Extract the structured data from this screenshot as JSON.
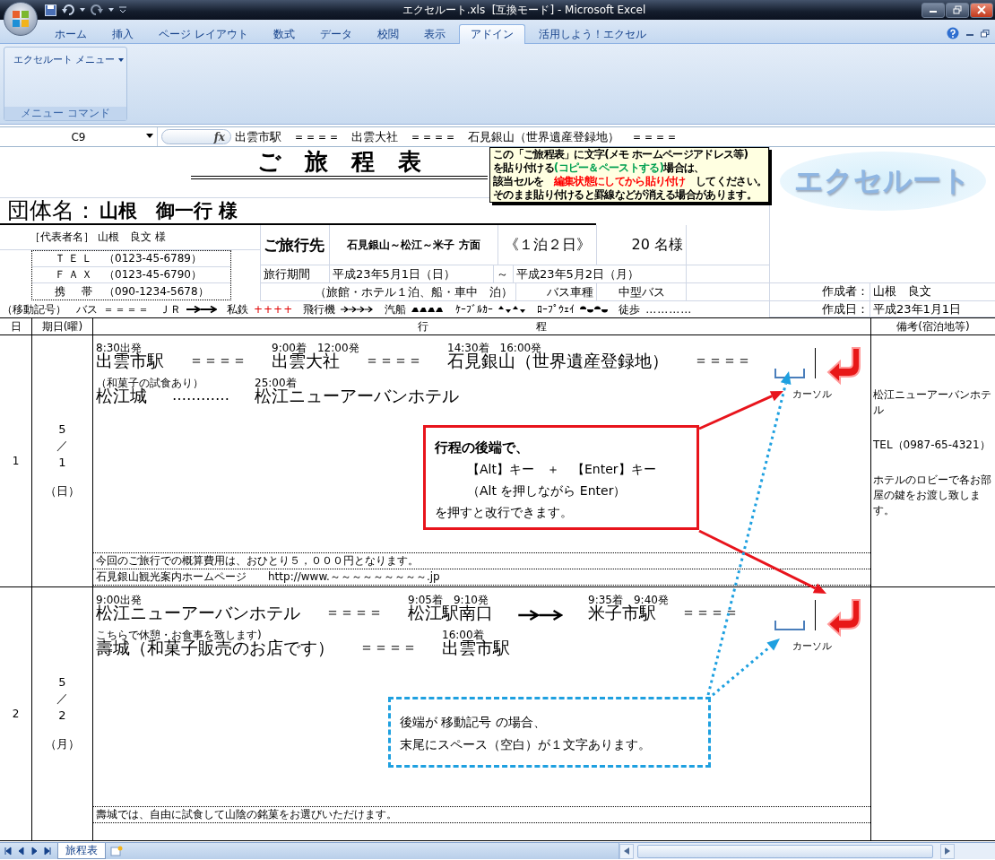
{
  "window": {
    "title": "エクセルート.xls  [互換モード] - Microsoft Excel"
  },
  "ribbon": {
    "tabs": [
      {
        "label": "ホーム",
        "selected": false
      },
      {
        "label": "挿入",
        "selected": false
      },
      {
        "label": "ページ レイアウト",
        "selected": false
      },
      {
        "label": "数式",
        "selected": false
      },
      {
        "label": "データ",
        "selected": false
      },
      {
        "label": "校閲",
        "selected": false
      },
      {
        "label": "表示",
        "selected": false
      },
      {
        "label": "アドイン",
        "selected": true
      },
      {
        "label": "活用しよう！エクセル",
        "selected": false
      }
    ],
    "menu_button": "エクセルート メニュー",
    "group_label": "メニュー コマンド"
  },
  "formula_bar": {
    "cell": "C9",
    "function_symbol": "fx",
    "content": "出雲市駅　＝＝＝＝　出雲大社　＝＝＝＝　石見銀山（世界遺産登録地）　＝＝＝＝"
  },
  "header": {
    "title": "ご　旅　程　表",
    "note": [
      [
        {
          "text": "この「ご旅程表」に文字(メモ ホームページアドレス等)"
        }
      ],
      [
        {
          "text": "を貼り付ける"
        },
        {
          "text": "(コピー＆ペーストする)",
          "color": "#00a050"
        },
        {
          "text": "場合は、"
        }
      ],
      [
        {
          "text": "該当セルを　"
        },
        {
          "text": "編集状態にしてから貼り付け",
          "color": "#ff0000"
        },
        {
          "text": "　してください。"
        }
      ],
      [
        {
          "text": "そのまま貼り付けると罫線などが消える場合があります。"
        }
      ]
    ],
    "logo": "エクセルート",
    "group_label": "団体名：",
    "group_name": "山根　御一行 様",
    "rep_label": "［代表者名］",
    "rep_name": "山根　良文 様",
    "contacts": [
      {
        "label": "ＴＥＬ",
        "value": "（0123-45-6789）"
      },
      {
        "label": "ＦＡＸ",
        "value": "（0123-45-6790）"
      },
      {
        "label": "携　帯",
        "value": "（090-1234-5678）"
      }
    ],
    "destination_label": "ご旅行先",
    "destination": "石見銀山～松江～米子 方面",
    "duration": "《１泊２日》",
    "party": "20 名様",
    "period_label": "旅行期間",
    "start": "平成23年5月1日（日）",
    "tilde": "～",
    "end": "平成23年5月2日（月）",
    "lodging": "（旅館・ホテル１泊、船・車中　泊）",
    "bus_label": "バス車種",
    "bus": "中型バス",
    "author_label": "作成者：",
    "author": "山根　良文",
    "created_label": "作成日：",
    "created": "平成23年1月1日",
    "legend_title": "（移動記号）",
    "legend": [
      {
        "label": "バス",
        "kind": "text",
        "symbol": "＝＝＝＝"
      },
      {
        "label": "ＪＲ",
        "kind": "jr"
      },
      {
        "label": "私鉄",
        "kind": "rail",
        "symbol": "++++"
      },
      {
        "label": "飛行機",
        "kind": "plane"
      },
      {
        "label": "汽船",
        "kind": "ship"
      },
      {
        "label": "ｹｰﾌﾞﾙｶｰ",
        "kind": "cable"
      },
      {
        "label": "ﾛｰﾌﾟｳｪｲ",
        "kind": "rope"
      },
      {
        "label": "徒歩",
        "kind": "text",
        "symbol": "…………"
      }
    ]
  },
  "table": {
    "columns": [
      "日",
      "期日(曜)",
      "行　　　　　　　　　　程",
      "備考(宿泊地等)"
    ],
    "days": [
      {
        "day": "1",
        "date": [
          "5",
          "／",
          "1"
        ],
        "weekday": "（日）",
        "lines": [
          {
            "items": [
              {
                "kind": "stop",
                "time": "8:30出発",
                "name": "出雲市駅"
              },
              {
                "kind": "text",
                "symbol": "＝＝＝＝"
              },
              {
                "kind": "stop",
                "time": "9:00着　12:00発",
                "name": "出雲大社"
              },
              {
                "kind": "text",
                "symbol": "＝＝＝＝"
              },
              {
                "kind": "stop",
                "time": "14:30着　16:00発",
                "name": "石見銀山（世界遺産登録地）"
              },
              {
                "kind": "text",
                "symbol": "＝＝＝＝"
              }
            ]
          },
          {
            "items": [
              {
                "kind": "stop",
                "time": "（和菓子の試食あり）",
                "name": "松江城"
              },
              {
                "kind": "text",
                "symbol": "…………"
              },
              {
                "kind": "stop",
                "time": "25:00着",
                "name": "松江ニューアーバンホテル"
              }
            ]
          }
        ],
        "cursor_label": "カーソル",
        "footer": [
          "今回のご旅行での概算費用は、おひとり５，０００円となります。",
          "石見銀山観光案内ホームページ　　http://www.～～～～～～～～～.jp"
        ],
        "remarks": [
          "松江ニューアーバンホテル",
          "TEL（0987-65-4321）",
          "ホテルのロビーで各お部屋の鍵をお渡し致します。"
        ]
      },
      {
        "day": "2",
        "date": [
          "5",
          "／",
          "2"
        ],
        "weekday": "（月）",
        "lines": [
          {
            "items": [
              {
                "kind": "stop",
                "time": "9:00出発",
                "name": "松江ニューアーバンホテル"
              },
              {
                "kind": "text",
                "symbol": "＝＝＝＝"
              },
              {
                "kind": "stop",
                "time": "9:05着　9:10発",
                "name": "松江駅南口"
              },
              {
                "kind": "jr"
              },
              {
                "kind": "stop",
                "time": "9:35着　9:40発",
                "name": "米子市駅"
              },
              {
                "kind": "text",
                "symbol": "＝＝＝＝"
              }
            ]
          },
          {
            "items": [
              {
                "kind": "stop",
                "time": "こちらで休憩・お食事を致します)",
                "name": "壽城（和菓子販売のお店です）"
              },
              {
                "kind": "text",
                "symbol": "＝＝＝＝"
              },
              {
                "kind": "stop",
                "time": "16:00着",
                "name": "出雲市駅"
              }
            ]
          }
        ],
        "cursor_label": "カーソル",
        "footer": [
          "壽城では、自由に試食して山陰の銘菓をお選びいただけます。"
        ]
      }
    ]
  },
  "red_callout": {
    "heading": "行程の後端で、",
    "details": [
      "【Alt】キー　＋　【Enter】キー",
      "（Alt を押しながら Enter）"
    ],
    "closing": "を押すと改行できます。"
  },
  "blue_callout": {
    "lines": [
      "後端が 移動記号 の場合、",
      "末尾にスペース（空白）が１文字あります。"
    ]
  },
  "sheet_tabs": [
    {
      "label": "旅程表",
      "selected": true
    }
  ]
}
